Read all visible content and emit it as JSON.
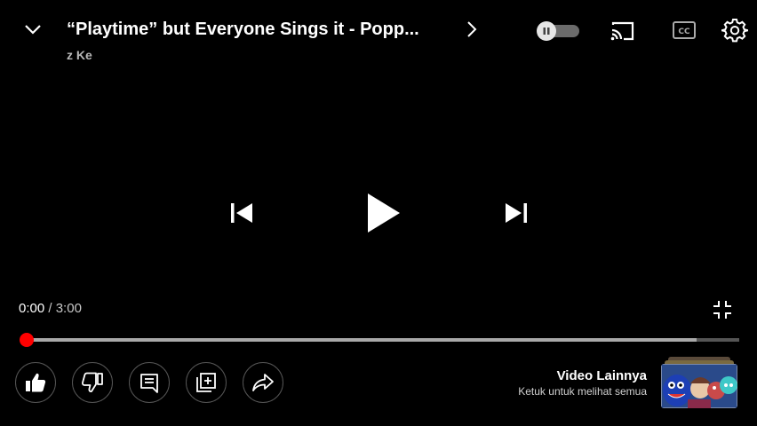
{
  "header": {
    "title": "“Playtime” but Everyone Sings it - Popp...",
    "channel": "z Ke",
    "icons": [
      "chevron-down-icon",
      "chevron-right-icon",
      "autoplay-toggle",
      "cast-icon",
      "cc-icon",
      "gear-icon"
    ]
  },
  "player": {
    "current_time": "0:00",
    "separator": " / ",
    "duration": "3:00",
    "played_fraction": 0.0,
    "buffered_fraction": 0.94,
    "autoplay_on": false,
    "icons": [
      "previous-icon",
      "play-icon",
      "next-icon",
      "exit-fullscreen-icon"
    ]
  },
  "actions": [
    {
      "name": "like",
      "icon": "thumbs-up-icon"
    },
    {
      "name": "dislike",
      "icon": "thumbs-down-icon"
    },
    {
      "name": "comments",
      "icon": "comment-icon"
    },
    {
      "name": "save",
      "icon": "add-to-playlist-icon"
    },
    {
      "name": "share",
      "icon": "share-icon"
    }
  ],
  "more_videos": {
    "title": "Video Lainnya",
    "subtitle": "Ketuk untuk melihat semua"
  },
  "colors": {
    "background": "#000000",
    "progress_played": "#ff0000",
    "progress_buffered": "#a8a8a8",
    "text_secondary": "#b8b8b8"
  }
}
